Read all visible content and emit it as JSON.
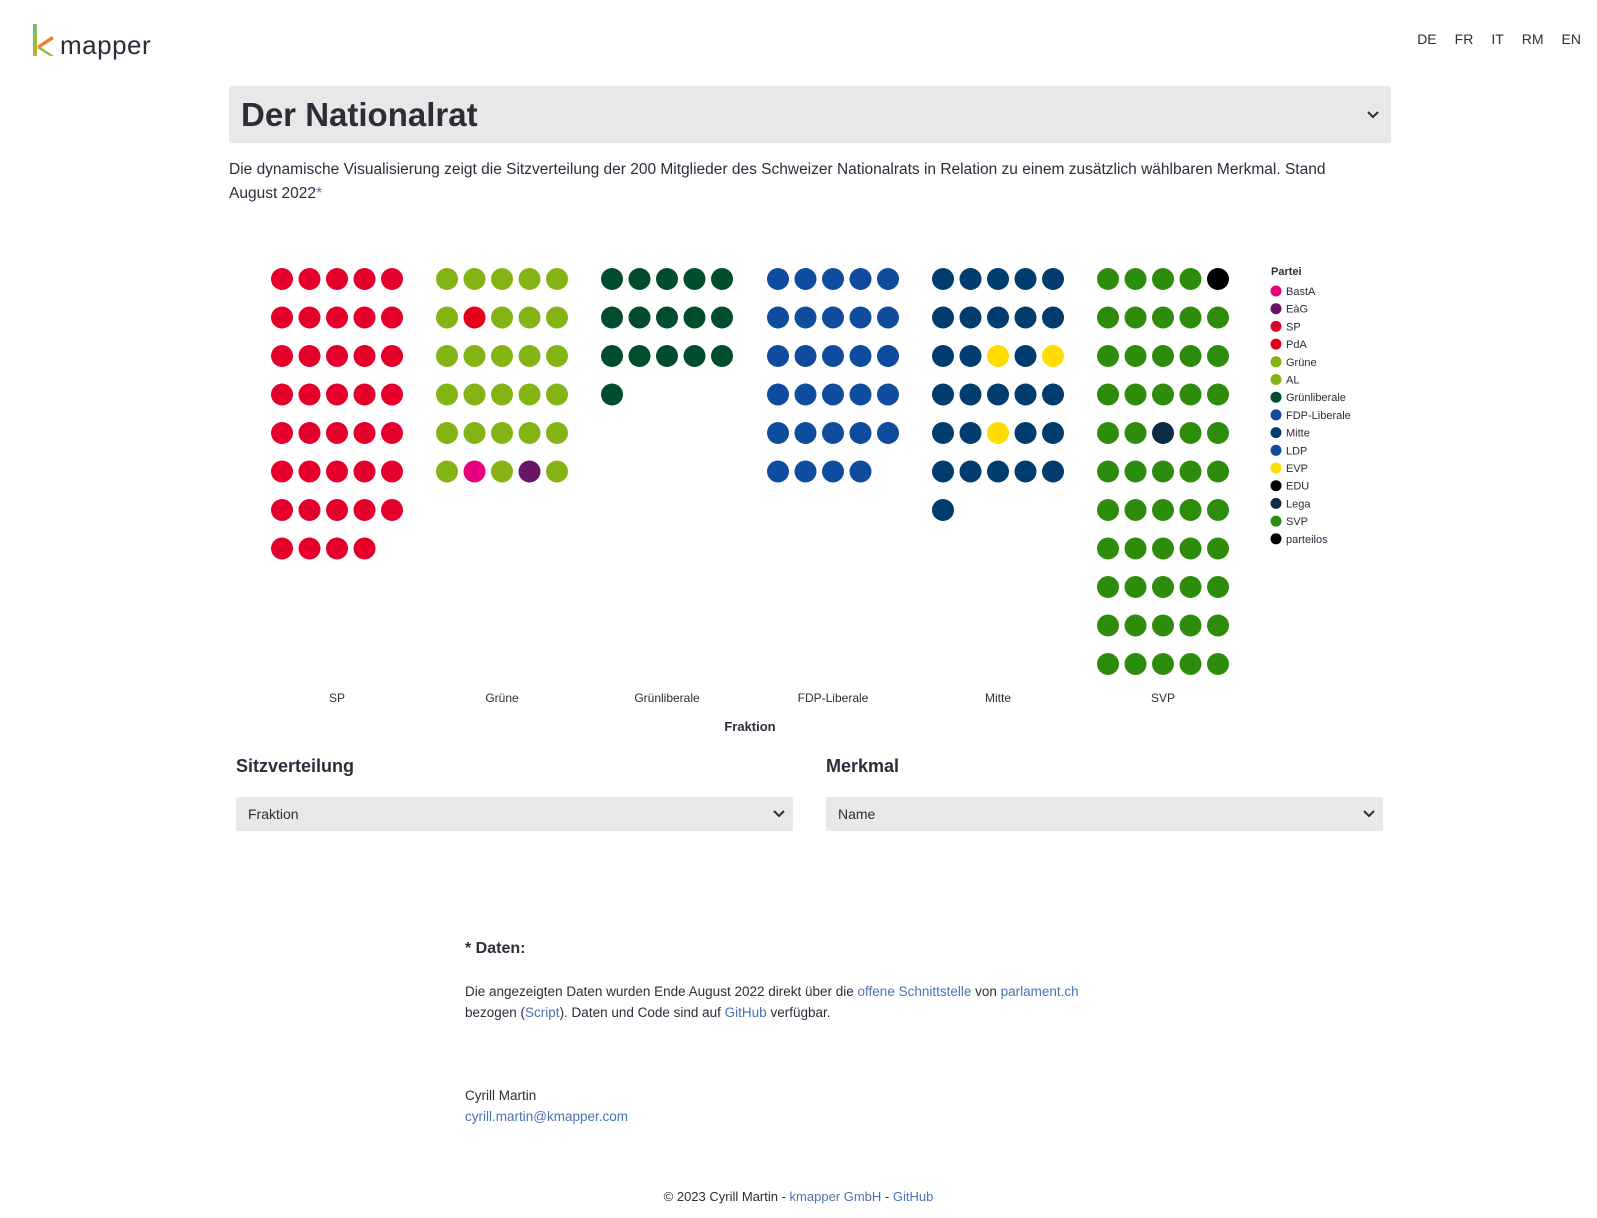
{
  "header": {
    "logo_text": "mapper",
    "languages": [
      "DE",
      "FR",
      "IT",
      "RM",
      "EN"
    ]
  },
  "title_select": {
    "value": "Der Nationalrat"
  },
  "intro": {
    "text": "Die dynamische Visualisierung zeigt die Sitzverteilung der 200 Mitglieder des Schweizer Nationalrats in Relation zu einem zusätzlich wählbaren Merkmal. Stand August 2022",
    "asterisk": "*"
  },
  "chart_data": {
    "type": "scatter",
    "x_axis_title": "Fraktion",
    "legend_title": "Partei",
    "legend_position": "right",
    "legend": [
      {
        "name": "BastA",
        "color": "#e6007e"
      },
      {
        "name": "EàG",
        "color": "#6a1466"
      },
      {
        "name": "SP",
        "color": "#e4002b"
      },
      {
        "name": "PdA",
        "color": "#e3001b"
      },
      {
        "name": "Grüne",
        "color": "#84b414"
      },
      {
        "name": "AL",
        "color": "#84b414"
      },
      {
        "name": "Grünliberale",
        "color": "#004d2e"
      },
      {
        "name": "FDP-Liberale",
        "color": "#0f4c9e"
      },
      {
        "name": "Mitte",
        "color": "#003c6e"
      },
      {
        "name": "LDP",
        "color": "#0f4c9e"
      },
      {
        "name": "EVP",
        "color": "#ffdd00"
      },
      {
        "name": "EDU",
        "color": "#000000"
      },
      {
        "name": "Lega",
        "color": "#0d2c45"
      },
      {
        "name": "SVP",
        "color": "#2e8c0d"
      },
      {
        "name": "parteilos",
        "color": "#000000"
      }
    ],
    "groups": [
      {
        "name": "SP",
        "seats": 39,
        "overrides": []
      },
      {
        "name": "Grüne",
        "seats": 30,
        "overrides": [
          {
            "index": 6,
            "party": "PdA"
          },
          {
            "index": 26,
            "party": "BastA"
          },
          {
            "index": 28,
            "party": "EàG"
          }
        ]
      },
      {
        "name": "Grünliberale",
        "seats": 16,
        "overrides": []
      },
      {
        "name": "FDP-Liberale",
        "seats": 29,
        "overrides": []
      },
      {
        "name": "Mitte",
        "seats": 31,
        "overrides": [
          {
            "index": 12,
            "party": "EVP"
          },
          {
            "index": 14,
            "party": "EVP"
          },
          {
            "index": 22,
            "party": "EVP"
          }
        ]
      },
      {
        "name": "SVP",
        "seats": 55,
        "overrides": [
          {
            "index": 4,
            "party": "EDU"
          },
          {
            "index": 22,
            "party": "Lega"
          }
        ]
      }
    ],
    "group_default_party": {
      "SP": "SP",
      "Grüne": "Grüne",
      "Grünliberale": "Grünliberale",
      "FDP-Liberale": "FDP-Liberale",
      "Mitte": "Mitte",
      "SVP": "SVP"
    }
  },
  "controls": {
    "distribution": {
      "label": "Sitzverteilung",
      "value": "Fraktion"
    },
    "feature": {
      "label": "Merkmal",
      "value": "Name"
    }
  },
  "notes": {
    "title": "* Daten:",
    "text1": "Die angezeigten Daten wurden Ende August 2022 direkt über die ",
    "link1": "offene Schnittstelle",
    "text2": " von ",
    "link2": "parlament.ch",
    "text3": " bezogen (",
    "link3": "Script",
    "text4": "). Daten und Code sind auf ",
    "link4": "GitHub",
    "text5": " verfügbar."
  },
  "author": {
    "name": "Cyrill Martin",
    "email": "cyrill.martin@kmapper.com"
  },
  "footer": {
    "copyright": "© 2023 Cyrill Martin - ",
    "company": "kmapper GmbH",
    "separator": " - ",
    "github": "GitHub"
  }
}
